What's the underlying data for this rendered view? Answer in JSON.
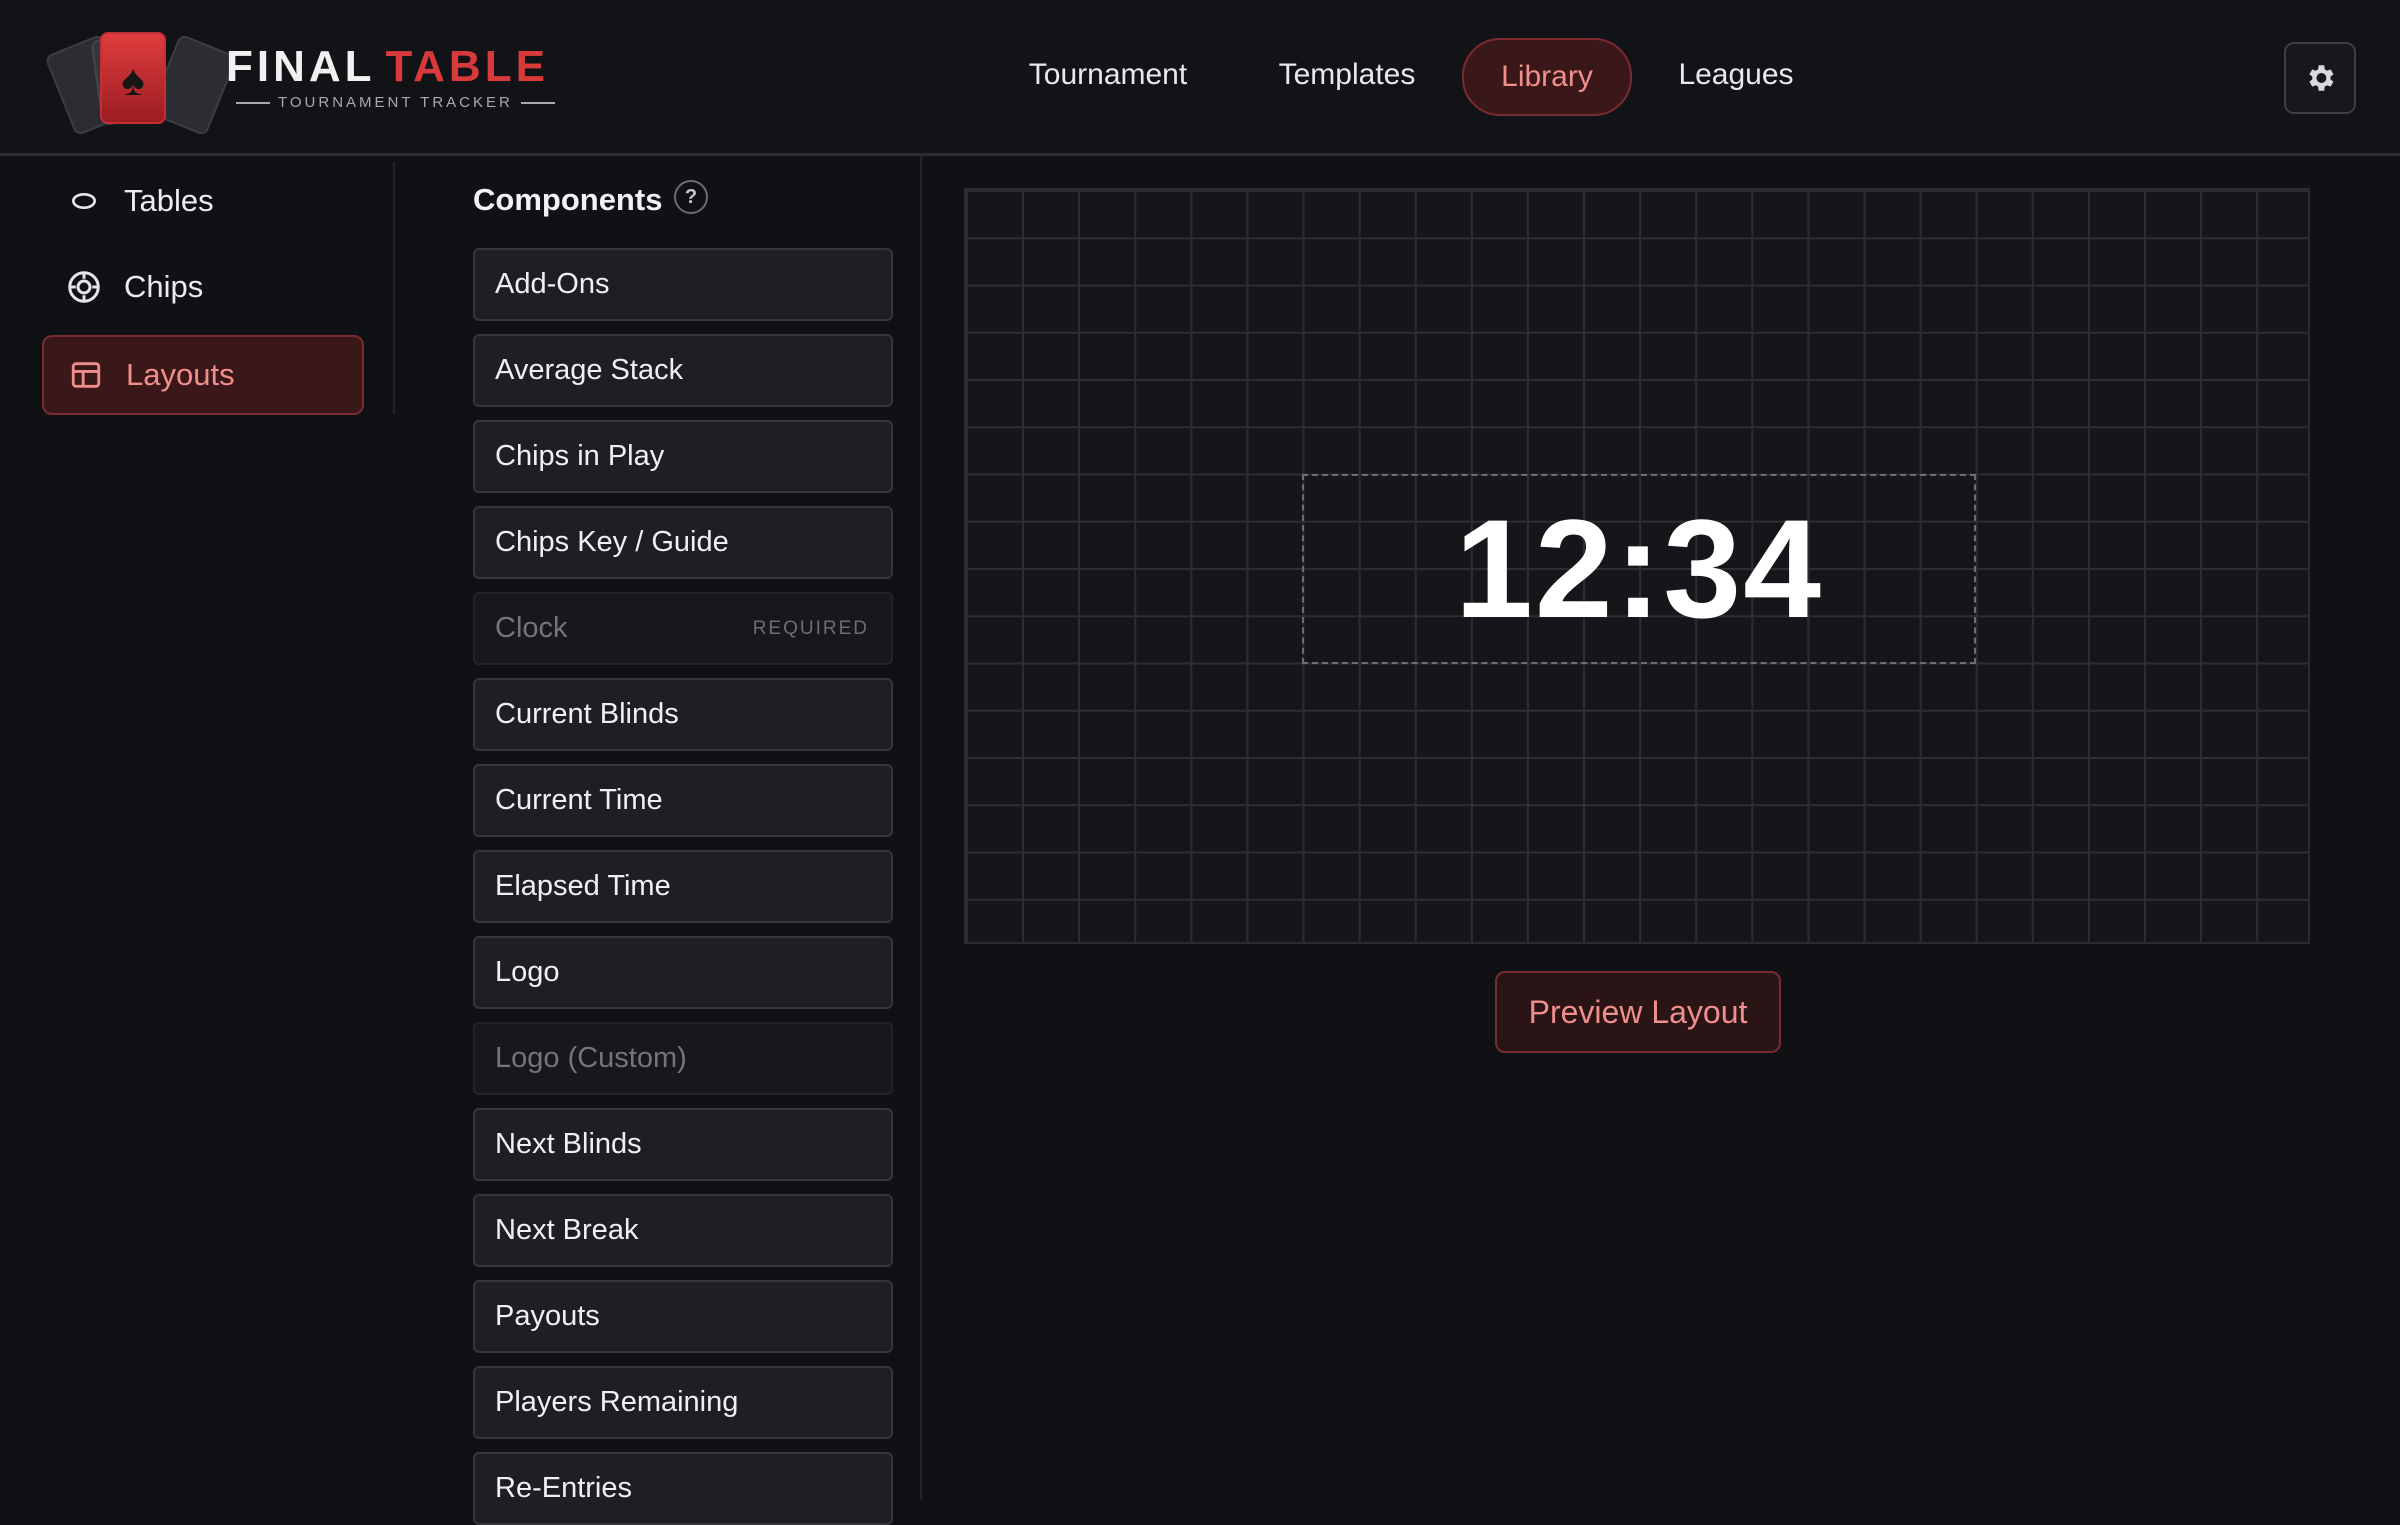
{
  "app": {
    "brand_word1": "FINAL",
    "brand_word2": "TABLE",
    "brand_subtitle": "TOURNAMENT TRACKER",
    "accent_color": "#d8393b"
  },
  "nav": {
    "items": [
      {
        "label": "Tournament",
        "active": false
      },
      {
        "label": "Templates",
        "active": false
      },
      {
        "label": "Library",
        "active": true
      },
      {
        "label": "Leagues",
        "active": false
      }
    ],
    "settings_icon": "gear-icon"
  },
  "sidebar": {
    "items": [
      {
        "label": "Tables",
        "icon": "table-icon",
        "active": false
      },
      {
        "label": "Chips",
        "icon": "chip-icon",
        "active": false
      },
      {
        "label": "Layouts",
        "icon": "layout-icon",
        "active": true
      }
    ]
  },
  "components": {
    "title": "Components",
    "help_symbol": "?",
    "items": [
      {
        "label": "Add-Ons",
        "disabled": false
      },
      {
        "label": "Average Stack",
        "disabled": false
      },
      {
        "label": "Chips in Play",
        "disabled": false
      },
      {
        "label": "Chips Key / Guide",
        "disabled": false
      },
      {
        "label": "Clock",
        "disabled": true,
        "badge": "REQUIRED"
      },
      {
        "label": "Current Blinds",
        "disabled": false
      },
      {
        "label": "Current Time",
        "disabled": false
      },
      {
        "label": "Elapsed Time",
        "disabled": false
      },
      {
        "label": "Logo",
        "disabled": false
      },
      {
        "label": "Logo (Custom)",
        "disabled": true
      },
      {
        "label": "Next Blinds",
        "disabled": false
      },
      {
        "label": "Next Break",
        "disabled": false
      },
      {
        "label": "Payouts",
        "disabled": false
      },
      {
        "label": "Players Remaining",
        "disabled": false
      },
      {
        "label": "Re-Entries",
        "disabled": false
      }
    ]
  },
  "canvas": {
    "clock_text": "12:34"
  },
  "preview_button": {
    "label": "Preview Layout"
  }
}
